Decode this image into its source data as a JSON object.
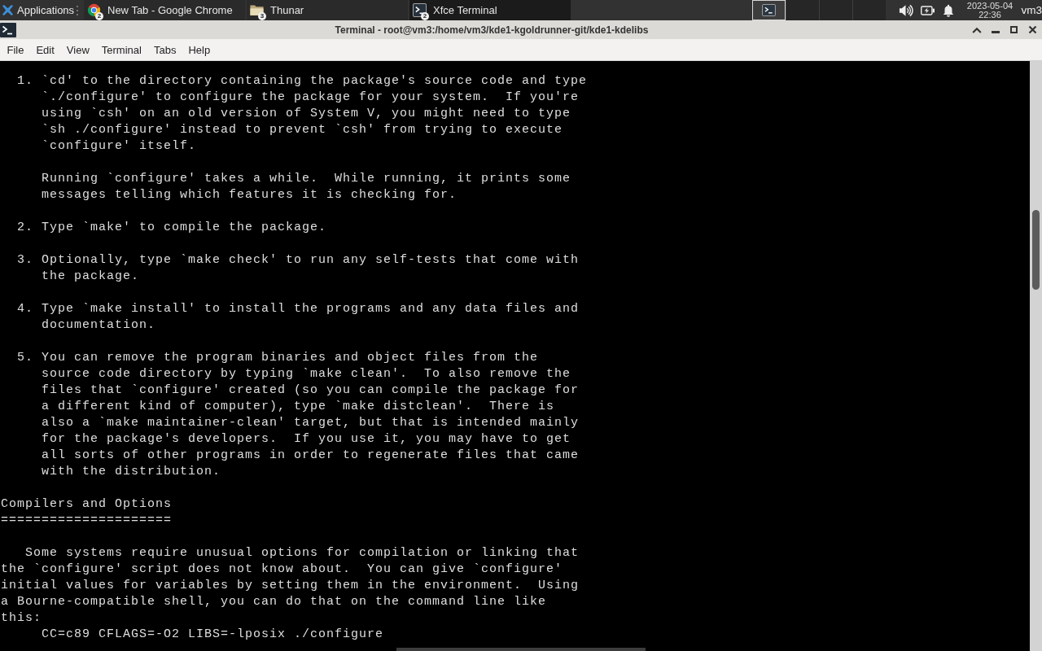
{
  "panel": {
    "app_menu": "Applications",
    "tasks": [
      {
        "label": "New Tab - Google Chrome",
        "count": "2",
        "kind": "browser",
        "selected": false
      },
      {
        "label": "Thunar",
        "count": "3",
        "kind": "folder",
        "selected": false
      },
      {
        "label": "Xfce Terminal",
        "count": "2",
        "kind": "terminal",
        "selected": true
      }
    ],
    "workspaces": [
      {
        "selected": true
      },
      {
        "selected": false
      },
      {
        "selected": false
      },
      {
        "selected": false
      }
    ],
    "clock": {
      "date": "2023-05-04",
      "time": "22:36"
    },
    "user": "vm3"
  },
  "window": {
    "title": "Terminal - root@vm3:/home/vm3/kde1-kgoldrunner-git/kde1-kdelibs"
  },
  "menu": [
    "File",
    "Edit",
    "View",
    "Terminal",
    "Tabs",
    "Help"
  ],
  "terminal": {
    "steps": [
      {
        "number": "1.",
        "paragraphs": [
          [
            "`cd' to the directory containing the package's source code and type",
            "`./configure' to configure the package for your system.  If you're",
            "using `csh' on an old version of System V, you might need to type",
            "`sh ./configure' instead to prevent `csh' from trying to execute",
            "`configure' itself."
          ],
          [
            "Running `configure' takes a while.  While running, it prints some",
            "messages telling which features it is checking for."
          ]
        ]
      },
      {
        "number": "2.",
        "paragraphs": [
          [
            "Type `make' to compile the package."
          ]
        ]
      },
      {
        "number": "3.",
        "paragraphs": [
          [
            "Optionally, type `make check' to run any self-tests that come with",
            "the package."
          ]
        ]
      },
      {
        "number": "4.",
        "paragraphs": [
          [
            "Type `make install' to install the programs and any data files and",
            "documentation."
          ]
        ]
      },
      {
        "number": "5.",
        "paragraphs": [
          [
            "You can remove the program binaries and object files from the",
            "source code directory by typing `make clean'.  To also remove the",
            "files that `configure' created (so you can compile the package for",
            "a different kind of computer), type `make distclean'.  There is",
            "also a `make maintainer-clean' target, but that is intended mainly",
            "for the package's developers.  If you use it, you may have to get",
            "all sorts of other programs in order to regenerate files that came",
            "with the distribution."
          ]
        ]
      }
    ],
    "section": {
      "heading": "Compilers and Options",
      "underline": "=====================",
      "paragraph": [
        "Some systems require unusual options for compilation or linking that",
        "the `configure' script does not know about.  You can give `configure'",
        "initial values for variables by setting them in the environment.  Using",
        "a Bourne-compatible shell, you can do that on the command line like",
        "this:"
      ],
      "command": "CC=c89 CFLAGS=-O2 LIBS=-lposix ./configure"
    }
  }
}
